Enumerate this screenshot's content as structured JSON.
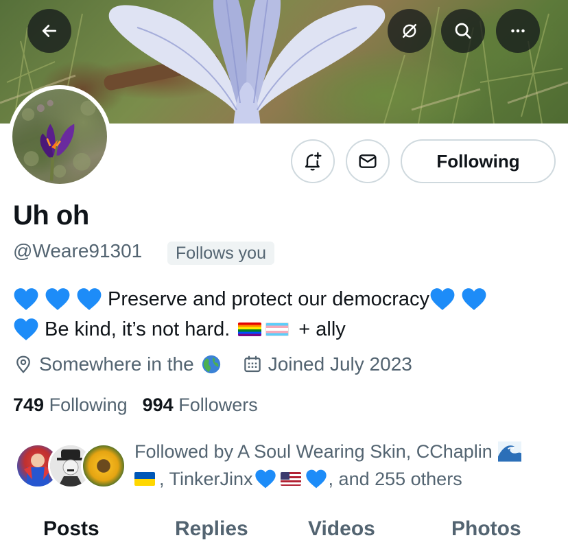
{
  "banner": {
    "back_icon": "arrow-left-icon",
    "grok_icon": "grok-slash-icon",
    "search_icon": "search-icon",
    "more_icon": "ellipsis-icon"
  },
  "profile": {
    "display_name": "Uh oh",
    "handle": "@Weare91301",
    "follows_you_badge": "Follows you"
  },
  "actions": {
    "notify_icon": "bell-plus-icon",
    "message_icon": "envelope-icon",
    "following_label": "Following"
  },
  "bio": {
    "line1_text": "Preserve and protect our democracy",
    "line2_text": "Be kind, it’s not hard.",
    "line2_suffix": "+ ally",
    "heart_color": "#1d8cf8"
  },
  "meta": {
    "location": "Somewhere in the",
    "joined": "Joined July 2023"
  },
  "stats": {
    "following_count": "749",
    "following_label": "Following",
    "followers_count": "994",
    "followers_label": "Followers"
  },
  "followed_by": {
    "prefix": "Followed by A Soul Wearing Skin, CChaplin",
    "line2_sep": ", TinkerJinx",
    "line2_suffix": ", and 255 others"
  },
  "tabs": [
    {
      "label": "Posts",
      "active": true
    },
    {
      "label": "Replies",
      "active": false
    },
    {
      "label": "Videos",
      "active": false
    },
    {
      "label": "Photos",
      "active": false
    }
  ]
}
